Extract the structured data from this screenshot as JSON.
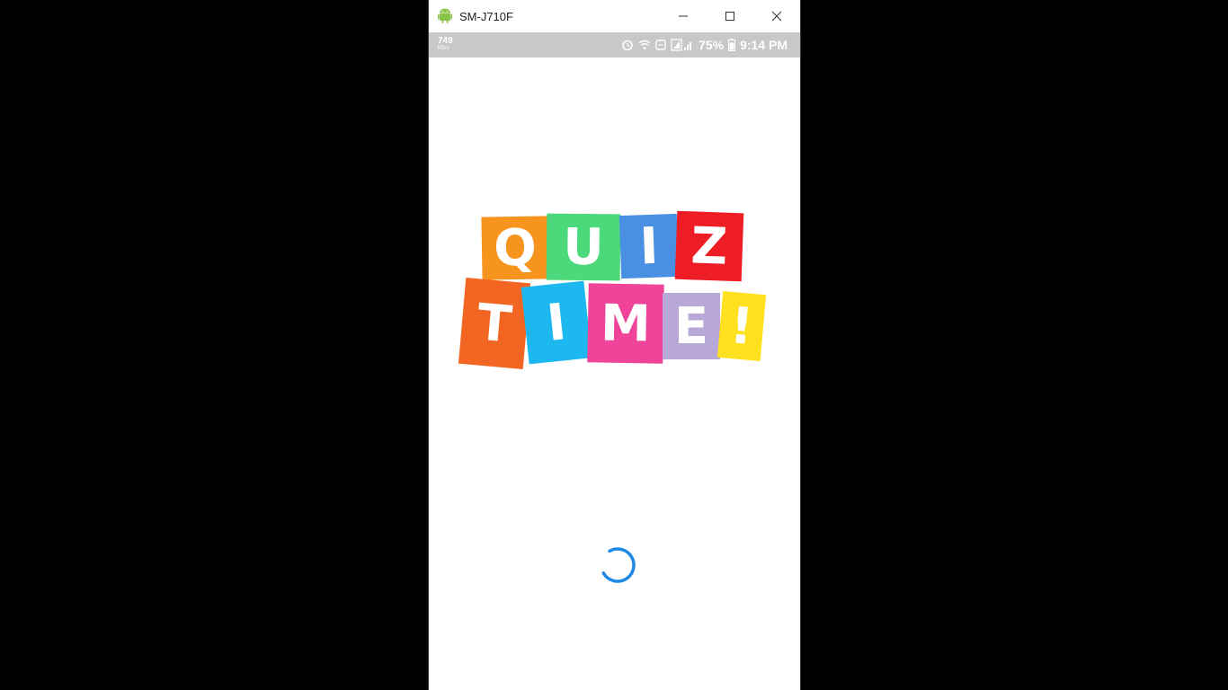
{
  "window": {
    "title": "SM-J710F",
    "minimize_icon": "minimize-icon",
    "maximize_icon": "maximize-icon",
    "close_icon": "close-icon"
  },
  "statusbar": {
    "net_speed_value": "749",
    "net_speed_unit": "KB/s",
    "battery_percent": "75%",
    "time": "9:14 PM",
    "icons": [
      "alarm-icon",
      "wifi-icon",
      "data-saver-icon",
      "signal-icon",
      "battery-icon"
    ]
  },
  "logo": {
    "row1": [
      {
        "letter": "Q",
        "color": "#F7941D"
      },
      {
        "letter": "U",
        "color": "#4CD97B"
      },
      {
        "letter": "I",
        "color": "#4A90E2"
      },
      {
        "letter": "Z",
        "color": "#EE1C25"
      }
    ],
    "row2": [
      {
        "letter": "T",
        "color": "#F26522"
      },
      {
        "letter": "I",
        "color": "#1EB8F0"
      },
      {
        "letter": "M",
        "color": "#F0449A"
      },
      {
        "letter": "E",
        "color": "#B7A8D8"
      },
      {
        "letter": "!",
        "color": "#FFE11F"
      }
    ]
  },
  "loading": {
    "icon": "loading-spinner-icon",
    "color": "#1E88E5"
  }
}
